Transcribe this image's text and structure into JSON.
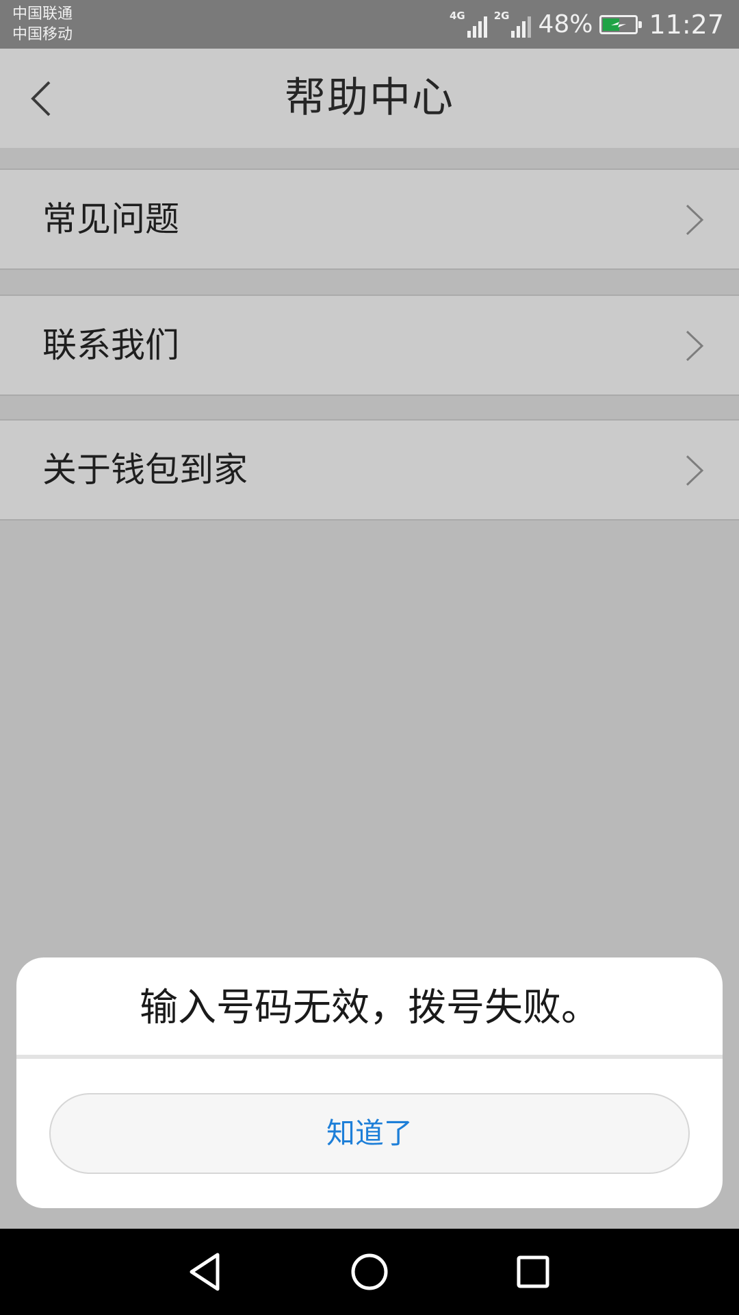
{
  "status_bar": {
    "carriers": [
      "中国联通",
      "中国移动"
    ],
    "network_1": "4G",
    "network_2": "2G",
    "battery_percent": "48%",
    "battery_level": 0.48,
    "charging": true,
    "time": "11:27"
  },
  "header": {
    "title": "帮助中心",
    "back_icon": "chevron-left-icon"
  },
  "menu": {
    "items": [
      {
        "label": "常见问题",
        "icon": "chevron-right-icon"
      },
      {
        "label": "联系我们",
        "icon": "chevron-right-icon"
      },
      {
        "label": "关于钱包到家",
        "icon": "chevron-right-icon"
      }
    ]
  },
  "dialog": {
    "message": "输入号码无效，拨号失败。",
    "button_label": "知道了"
  },
  "nav_bar": {
    "back_icon": "triangle-back-icon",
    "home_icon": "circle-home-icon",
    "recents_icon": "square-recents-icon"
  },
  "colors": {
    "accent": "#1e7fd8",
    "battery": "#1fa345",
    "status_bar": "#7a7a7a",
    "overlay_bg": "#b9b9b9"
  }
}
